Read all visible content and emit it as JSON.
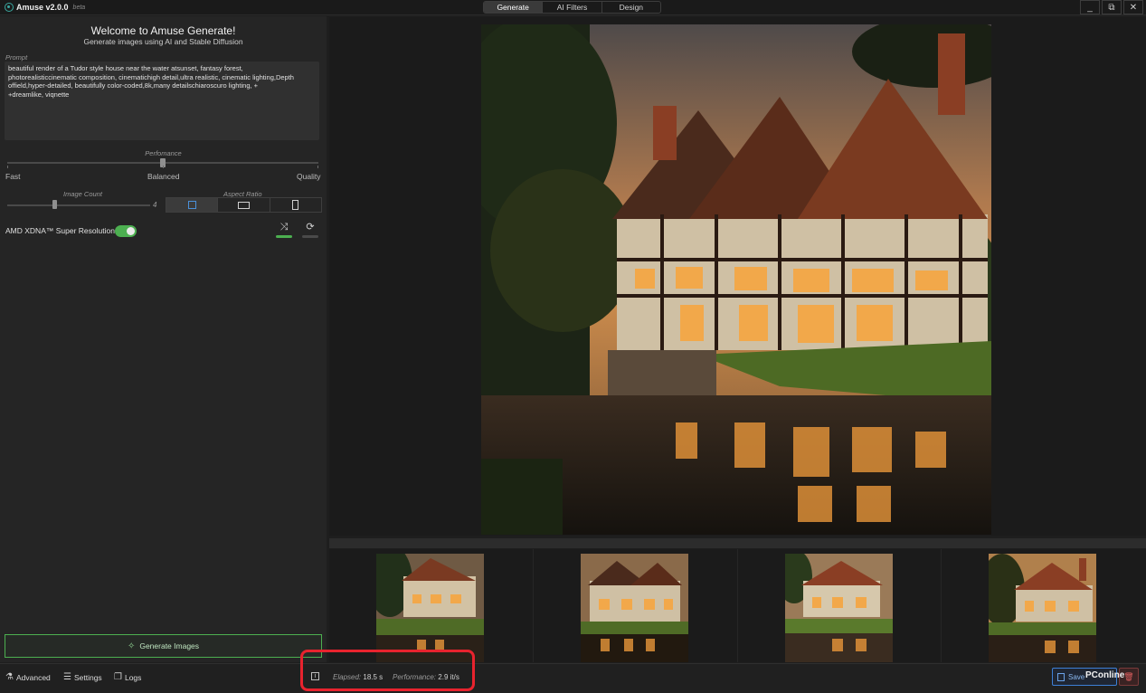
{
  "app": {
    "name": "Amuse v2.0.0",
    "badge": "beta"
  },
  "tabs": [
    {
      "label": "Generate",
      "active": true
    },
    {
      "label": "AI Filters",
      "active": false
    },
    {
      "label": "Design",
      "active": false
    }
  ],
  "window_controls": {
    "minimize": "_",
    "restore": "⧉",
    "close": "✕"
  },
  "left": {
    "welcome_title": "Welcome to Amuse Generate!",
    "welcome_subtitle": "Generate images using AI and Stable Diffusion",
    "prompt_label": "Prompt",
    "prompt_lines": [
      "beautiful render of a Tudor style house near the water atsunset,  fantasy forest,",
      "photorealisticcinematic composition, cinematichigh detail,ultra realistic, cinematic lighting,Depth",
      "offield,hyper-detailed,  beautifully color-coded,8k,many detailschiaroscuro lighting,  +",
      "+dreamlike,  viqnette"
    ],
    "performance_label": "Perfomance",
    "performance_ticks": {
      "fast": "Fast",
      "balanced": "Balanced",
      "quality": "Quality"
    },
    "performance_level": 0.5,
    "image_count_label": "Image Count",
    "image_count_value": "4",
    "image_count_level": 0.33,
    "aspect_ratio_label": "Aspect Ratio",
    "aspect_options": [
      {
        "shape": "square",
        "active": true
      },
      {
        "shape": "landscape",
        "active": false
      },
      {
        "shape": "portrait",
        "active": false
      }
    ],
    "super_resolution_label": "AMD XDNA™ Super Resolution",
    "super_resolution_enabled": true,
    "random_icon": "shuffle-icon",
    "reset_icon": "refresh-icon",
    "generate_button": "Generate Images"
  },
  "colors": {
    "accent_green": "#4caf50",
    "highlight_red": "#e8232e",
    "save_blue": "#3d7fd6"
  },
  "bottom": {
    "advanced": "Advanced",
    "settings": "Settings",
    "logs": "Logs",
    "elapsed_label": "Elapsed:",
    "elapsed_value": "18.5 s",
    "performance_label": "Performance:",
    "performance_value": "2.9 it/s",
    "save_label": "Save",
    "watermark": "PConline"
  },
  "thumbnails_count": 4
}
